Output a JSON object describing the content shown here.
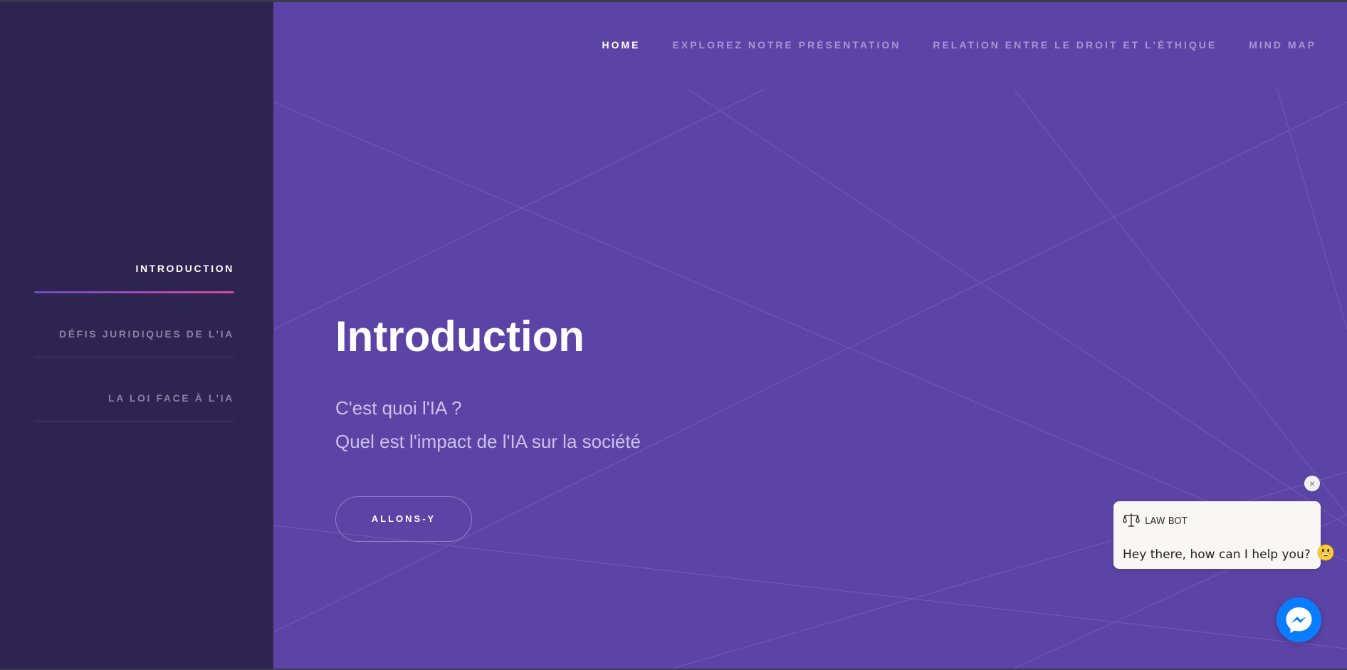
{
  "sidebar": {
    "items": [
      {
        "label": "INTRODUCTION",
        "active": true
      },
      {
        "label": "DÉFIS JURIDIQUES DE L’IA",
        "active": false
      },
      {
        "label": "LA LOI FACE À L’IA",
        "active": false
      }
    ]
  },
  "nav": {
    "items": [
      {
        "label": "HOME",
        "current": true
      },
      {
        "label": "EXPLOREZ NOTRE PRÈSENTATION",
        "current": false
      },
      {
        "label": "RELATION ENTRE LE DROIT ET L'ÉTHIQUE",
        "current": false
      },
      {
        "label": "MIND MAP",
        "current": false
      }
    ]
  },
  "hero": {
    "title": "Introduction",
    "line1": "C'est quoi l'IA ?",
    "line2": "Quel est l'impact de l'IA sur la société",
    "cta_label": "ALLONS-Y"
  },
  "chat": {
    "close_symbol": "×",
    "bot_name": "LAW BOT",
    "message": "Hey there, how can I help you?",
    "bot_icon": "scales-icon",
    "emoji_icon": "grinning-face-icon",
    "launcher_icon": "messenger-icon"
  },
  "colors": {
    "sidebar_bg": "#2e2450",
    "main_bg": "#5c44a6",
    "accent_gradient_start": "#6a4bc4",
    "accent_gradient_end": "#d64aa0",
    "messenger_blue": "#0a7cff"
  }
}
